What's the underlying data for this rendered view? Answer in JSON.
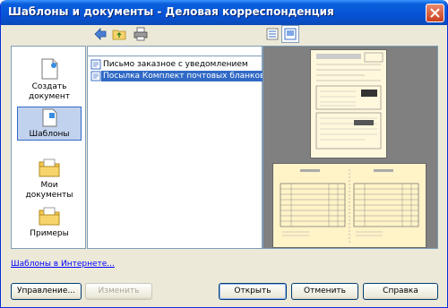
{
  "window": {
    "title": "Шаблоны и документы - Деловая корреспонденция"
  },
  "toolbar": {
    "back_icon": "back-arrow-icon",
    "folder_icon": "up-folder-icon",
    "print_icon": "print-icon",
    "view_list_icon": "view-list-icon",
    "view_preview_icon": "view-preview-icon"
  },
  "sidebar": {
    "items": [
      {
        "label": "Создать документ",
        "icon": "new-document-icon",
        "selected": false
      },
      {
        "label": "Шаблоны",
        "icon": "templates-icon",
        "selected": true
      },
      {
        "label": "Мои документы",
        "icon": "my-documents-folder-icon",
        "selected": false
      },
      {
        "label": "Примеры",
        "icon": "examples-folder-icon",
        "selected": false
      }
    ]
  },
  "files": {
    "items": [
      {
        "label": "Письмо заказное с уведомлением",
        "selected": false
      },
      {
        "label": "Посылка Комплект почтовых бланков",
        "selected": true
      }
    ]
  },
  "link": {
    "label": "Шаблоны в Интернете..."
  },
  "buttons": {
    "manage": "Управление...",
    "edit": "Изменить",
    "open": "Открыть",
    "cancel": "Отменить",
    "help": "Справка"
  },
  "colors": {
    "titlebar": "#0653d6",
    "selection": "#316ac5",
    "link": "#0000ff",
    "window_bg": "#ece9d8"
  }
}
